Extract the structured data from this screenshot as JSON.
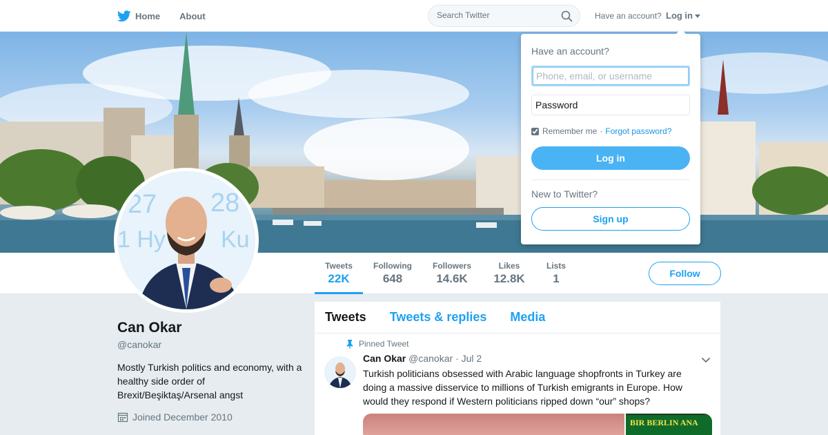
{
  "nav": {
    "home_label": "Home",
    "about_label": "About",
    "search_placeholder": "Search Twitter",
    "have_account": "Have an account?",
    "login_label": "Log in"
  },
  "stats": [
    {
      "label": "Tweets",
      "value": "22K",
      "active": true
    },
    {
      "label": "Following",
      "value": "648",
      "active": false
    },
    {
      "label": "Followers",
      "value": "14.6K",
      "active": false
    },
    {
      "label": "Likes",
      "value": "12.8K",
      "active": false
    },
    {
      "label": "Lists",
      "value": "1",
      "active": false
    }
  ],
  "follow_label": "Follow",
  "profile": {
    "name": "Can Okar",
    "handle": "@canokar",
    "bio": "Mostly Turkish politics and economy, with a healthy side order of Brexit/Beşiktaş/Arsenal angst",
    "joined": "Joined December 2010"
  },
  "timeline": {
    "tabs": [
      {
        "label": "Tweets",
        "active": true
      },
      {
        "label": "Tweets & replies",
        "active": false
      },
      {
        "label": "Media",
        "active": false
      }
    ],
    "tweet": {
      "pinned_label": "Pinned Tweet",
      "name": "Can Okar",
      "handle": "@canokar",
      "separator": "·",
      "date": "Jul 2",
      "text": "Turkish politicians obsessed with Arabic language shopfronts in Turkey are doing a massive disservice to millions of Turkish emigrants in Europe. How would they respond if Western politicians ripped down “our” shops?",
      "media_sign_text": "BIR BERLIN ANA"
    }
  },
  "login_dropdown": {
    "title": "Have an account?",
    "username_placeholder": "Phone, email, or username",
    "password_placeholder": "Password",
    "remember_label": "Remember me",
    "separator": "·",
    "forgot_label": "Forgot password?",
    "remember_checked": true,
    "login_button": "Log in",
    "new_label": "New to Twitter?",
    "signup_button": "Sign up"
  },
  "colors": {
    "accent": "#1da1f2",
    "login_button": "#4ab3f4",
    "background": "#e6ecf0"
  }
}
